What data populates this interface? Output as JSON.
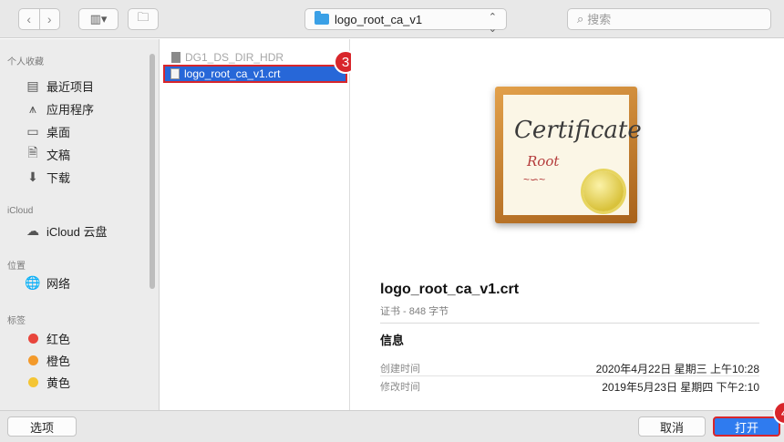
{
  "toolbar": {
    "back_icon": "chevron-left-icon",
    "forward_icon": "chevron-right-icon",
    "view_icon": "column-view-icon",
    "new_folder_icon": "new-folder-icon",
    "current_folder": "logo_root_ca_v1",
    "search_placeholder": "搜索"
  },
  "sidebar": {
    "sections": [
      {
        "header": "个人收藏",
        "items": [
          {
            "label": "最近项目",
            "icon": "recents-icon"
          },
          {
            "label": "应用程序",
            "icon": "applications-icon"
          },
          {
            "label": "桌面",
            "icon": "desktop-icon"
          },
          {
            "label": "文稿",
            "icon": "documents-icon"
          },
          {
            "label": "下载",
            "icon": "downloads-icon"
          }
        ]
      },
      {
        "header": "iCloud",
        "items": [
          {
            "label": "iCloud 云盘",
            "icon": "cloud-icon"
          }
        ]
      },
      {
        "header": "位置",
        "items": [
          {
            "label": "网络",
            "icon": "network-icon"
          }
        ]
      },
      {
        "header": "标签",
        "items": [
          {
            "label": "红色",
            "color": "#e8453c"
          },
          {
            "label": "橙色",
            "color": "#f39a2b"
          },
          {
            "label": "黄色",
            "color": "#f4c534"
          }
        ]
      }
    ]
  },
  "file_list": {
    "items": [
      {
        "name": "DG1_DS_DIR_HDR",
        "state": "disabled"
      },
      {
        "name": "logo_root_ca_v1.crt",
        "state": "selected"
      }
    ]
  },
  "callouts": {
    "step_file": "3",
    "step_open": "4"
  },
  "preview": {
    "cert_title": "Certificate",
    "cert_subtitle": "Root",
    "file_name": "logo_root_ca_v1.crt",
    "kind_size": "证书 - 848 字节",
    "info_header": "信息",
    "created_label": "创建时间",
    "created_value": "2020年4月22日 星期三 上午10:28",
    "modified_label": "修改时间",
    "modified_value": "2019年5月23日 星期四 下午2:10"
  },
  "bottom": {
    "options_label": "选项",
    "cancel_label": "取消",
    "open_label": "打开"
  }
}
